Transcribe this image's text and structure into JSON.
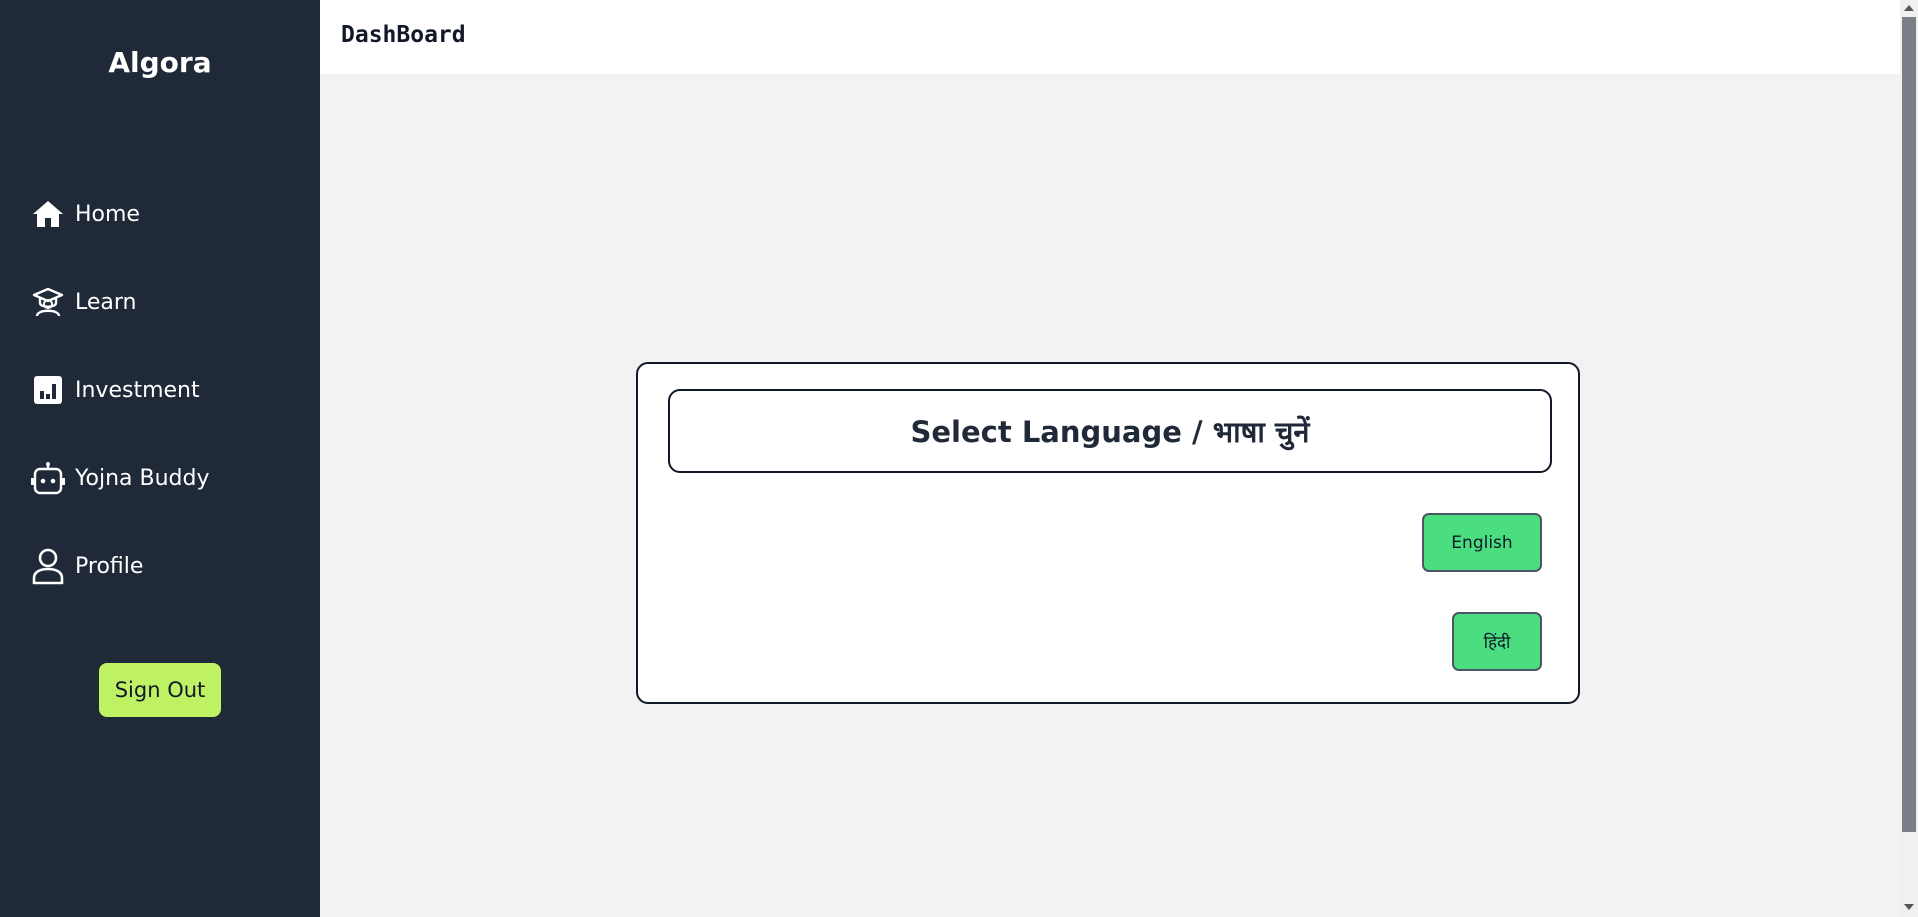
{
  "sidebar": {
    "brand": "Algora",
    "items": [
      {
        "label": "Home",
        "icon": "home-icon"
      },
      {
        "label": "Learn",
        "icon": "graduate-icon"
      },
      {
        "label": "Investment",
        "icon": "chart-icon"
      },
      {
        "label": "Yojna Buddy",
        "icon": "robot-icon"
      },
      {
        "label": "Profile",
        "icon": "user-icon"
      }
    ],
    "sign_out_label": "Sign Out"
  },
  "header": {
    "title": "DashBoard"
  },
  "language_card": {
    "title": "Select Language / भाषा चुनें",
    "options": [
      {
        "label": "English"
      },
      {
        "label": "हिंदी"
      }
    ]
  },
  "colors": {
    "sidebar_bg": "#1f2937",
    "sign_out_bg": "#bef264",
    "language_button_bg": "#4ade80",
    "content_bg": "#f2f2f2"
  }
}
